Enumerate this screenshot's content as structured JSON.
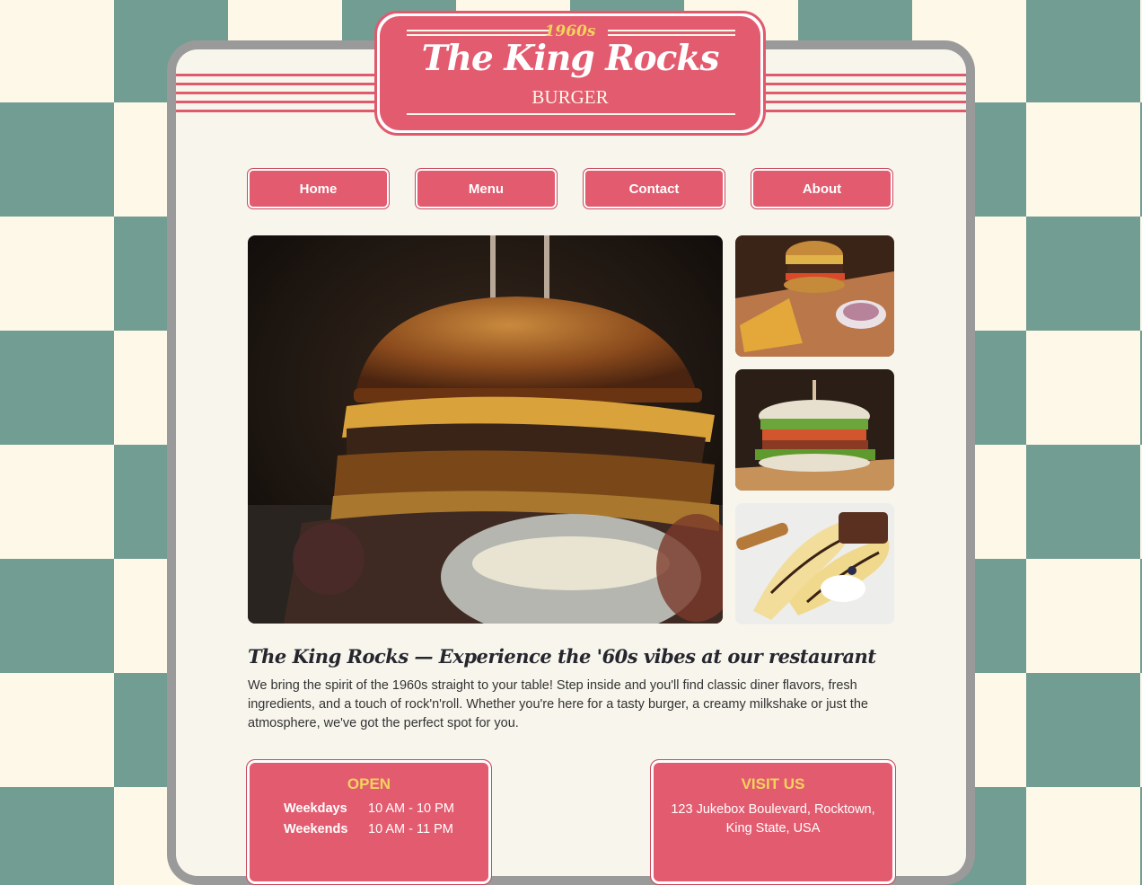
{
  "logo": {
    "era": "1960s",
    "name": "The King Rocks",
    "subtitle": "BURGER"
  },
  "nav": {
    "items": [
      {
        "label": "Home"
      },
      {
        "label": "Menu"
      },
      {
        "label": "Contact"
      },
      {
        "label": "About"
      }
    ]
  },
  "gallery": {
    "main_photo": "burger-photo",
    "side_photos": [
      "burger-fries-photo",
      "sandwich-photo",
      "dessert-photo"
    ]
  },
  "intro": {
    "headline": "The King Rocks — Experience the '60s vibes at our restaurant",
    "text": "We bring the spirit of the 1960s straight to your table! Step inside and you'll find classic diner flavors, fresh ingredients, and a touch of rock'n'roll. Whether you're here for a tasty burger, a creamy milkshake or just the atmosphere, we've got the perfect spot for you."
  },
  "open": {
    "title": "OPEN",
    "rows": [
      {
        "day": "Weekdays",
        "time": "10 AM - 10 PM"
      },
      {
        "day": "Weekends",
        "time": "10 AM - 11 PM"
      }
    ]
  },
  "visit": {
    "title": "VISIT US",
    "address_line1": "123 Jukebox Boulevard, Rocktown,",
    "address_line2": "King State, USA"
  },
  "colors": {
    "accent": "#e35b6f",
    "checker_green": "#729d93",
    "checker_cream": "#fdf8e8",
    "panel": "#f7f5ec",
    "highlight_yellow": "#f3d35c"
  }
}
